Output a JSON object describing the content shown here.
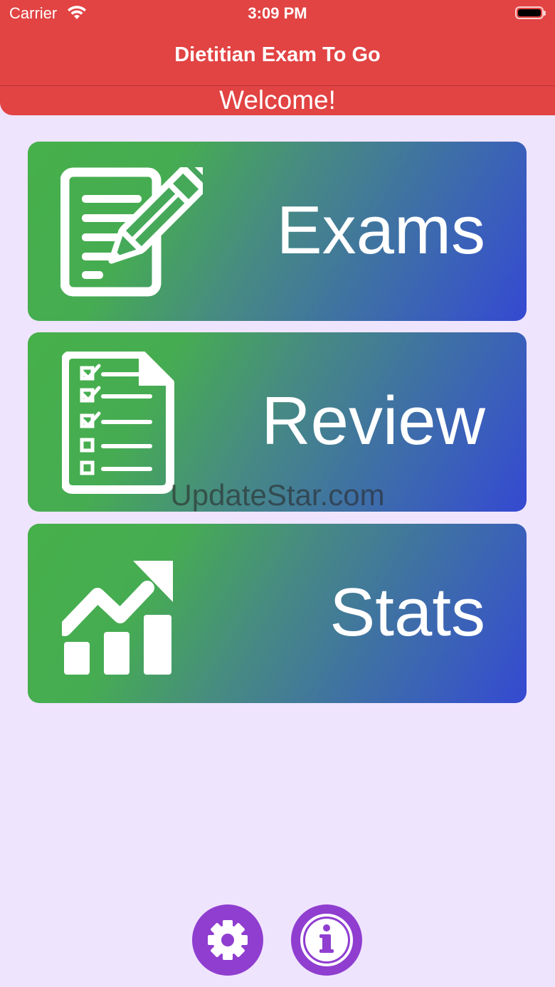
{
  "status_bar": {
    "carrier": "Carrier",
    "time": "3:09 PM"
  },
  "header": {
    "title": "Dietitian Exam To Go",
    "welcome": "Welcome!"
  },
  "menu": [
    {
      "label": "Exams",
      "icon": "exam-pencil-icon"
    },
    {
      "label": "Review",
      "icon": "checklist-icon"
    },
    {
      "label": "Stats",
      "icon": "stats-chart-icon"
    }
  ],
  "watermark": "UpdateStar.com",
  "bottom_buttons": [
    {
      "icon": "gear-icon"
    },
    {
      "icon": "info-icon"
    }
  ],
  "colors": {
    "header": "#e24343",
    "background": "#efe4fd",
    "gradient_start": "#46b04a",
    "gradient_end": "#3549d2",
    "round_button": "#8f3ed0"
  }
}
